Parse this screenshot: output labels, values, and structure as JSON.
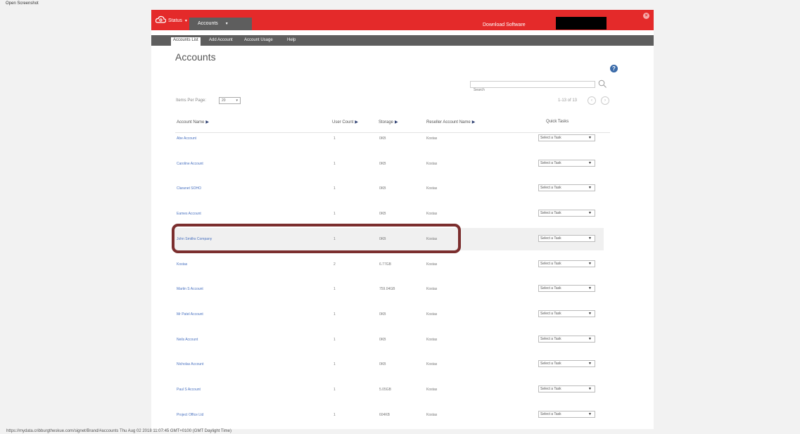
{
  "screen_label": "Open Screenshot",
  "status_bar_url": "https://mydata.cribburgtheskue.com/signet/Brand/#accounts Thu Aug 02 2018 11:07:45 GMT+0100 (GMT Daylight Time)",
  "colors": {
    "header_red": "#e42a2a",
    "subnav_gray": "#5e5e5e",
    "link_blue": "#4a72c0",
    "annotation": "#7b2e2e"
  },
  "topbar": {
    "logo_icon": "cloud-logo-icon",
    "status_label": "Status",
    "accounts_label": "Accounts",
    "download_label": "Download Software",
    "close_icon": "close-icon"
  },
  "subnav": {
    "tabs": [
      "Accounts List",
      "Add Account",
      "Account Usage",
      "Help"
    ],
    "active_tab": "Accounts List"
  },
  "page": {
    "title": "Accounts",
    "help_glyph": "?",
    "search_placeholder": "Search",
    "items_per_page_label": "Items Per Page:",
    "items_per_page_value": "20",
    "range_text": "1-13 of 13"
  },
  "table": {
    "columns": {
      "name": "Account Name",
      "users": "User Count",
      "storage": "Storage",
      "reseller": "Reseller Account Name",
      "tasks": "Quick Tasks"
    },
    "task_placeholder": "Select a Task",
    "highlighted_row": "John Smiths Company",
    "rows": [
      {
        "name": "Abe Account",
        "users": "1",
        "storage": "0KB",
        "reseller": "Kostas"
      },
      {
        "name": "Caroline Account",
        "users": "1",
        "storage": "0KB",
        "reseller": "Kostas"
      },
      {
        "name": "Claranet SOHO",
        "users": "1",
        "storage": "0KB",
        "reseller": "Kostas"
      },
      {
        "name": "Eames Account",
        "users": "1",
        "storage": "0KB",
        "reseller": "Kostas"
      },
      {
        "name": "John Smiths Company",
        "users": "1",
        "storage": "0KB",
        "reseller": "Kostas"
      },
      {
        "name": "Kostas",
        "users": "2",
        "storage": "6.77GB",
        "reseller": "Kostas"
      },
      {
        "name": "Martin S Account",
        "users": "1",
        "storage": "759.04GB",
        "reseller": "Kostas"
      },
      {
        "name": "Mr Patel Account",
        "users": "1",
        "storage": "0KB",
        "reseller": "Kostas"
      },
      {
        "name": "Neils Account",
        "users": "1",
        "storage": "0KB",
        "reseller": "Kostas"
      },
      {
        "name": "Nicholas Account",
        "users": "1",
        "storage": "0KB",
        "reseller": "Kostas"
      },
      {
        "name": "Paul S Account",
        "users": "1",
        "storage": "5.05GB",
        "reseller": "Kostas"
      },
      {
        "name": "Project Office Ltd",
        "users": "1",
        "storage": "604KB",
        "reseller": "Kostas"
      }
    ]
  }
}
